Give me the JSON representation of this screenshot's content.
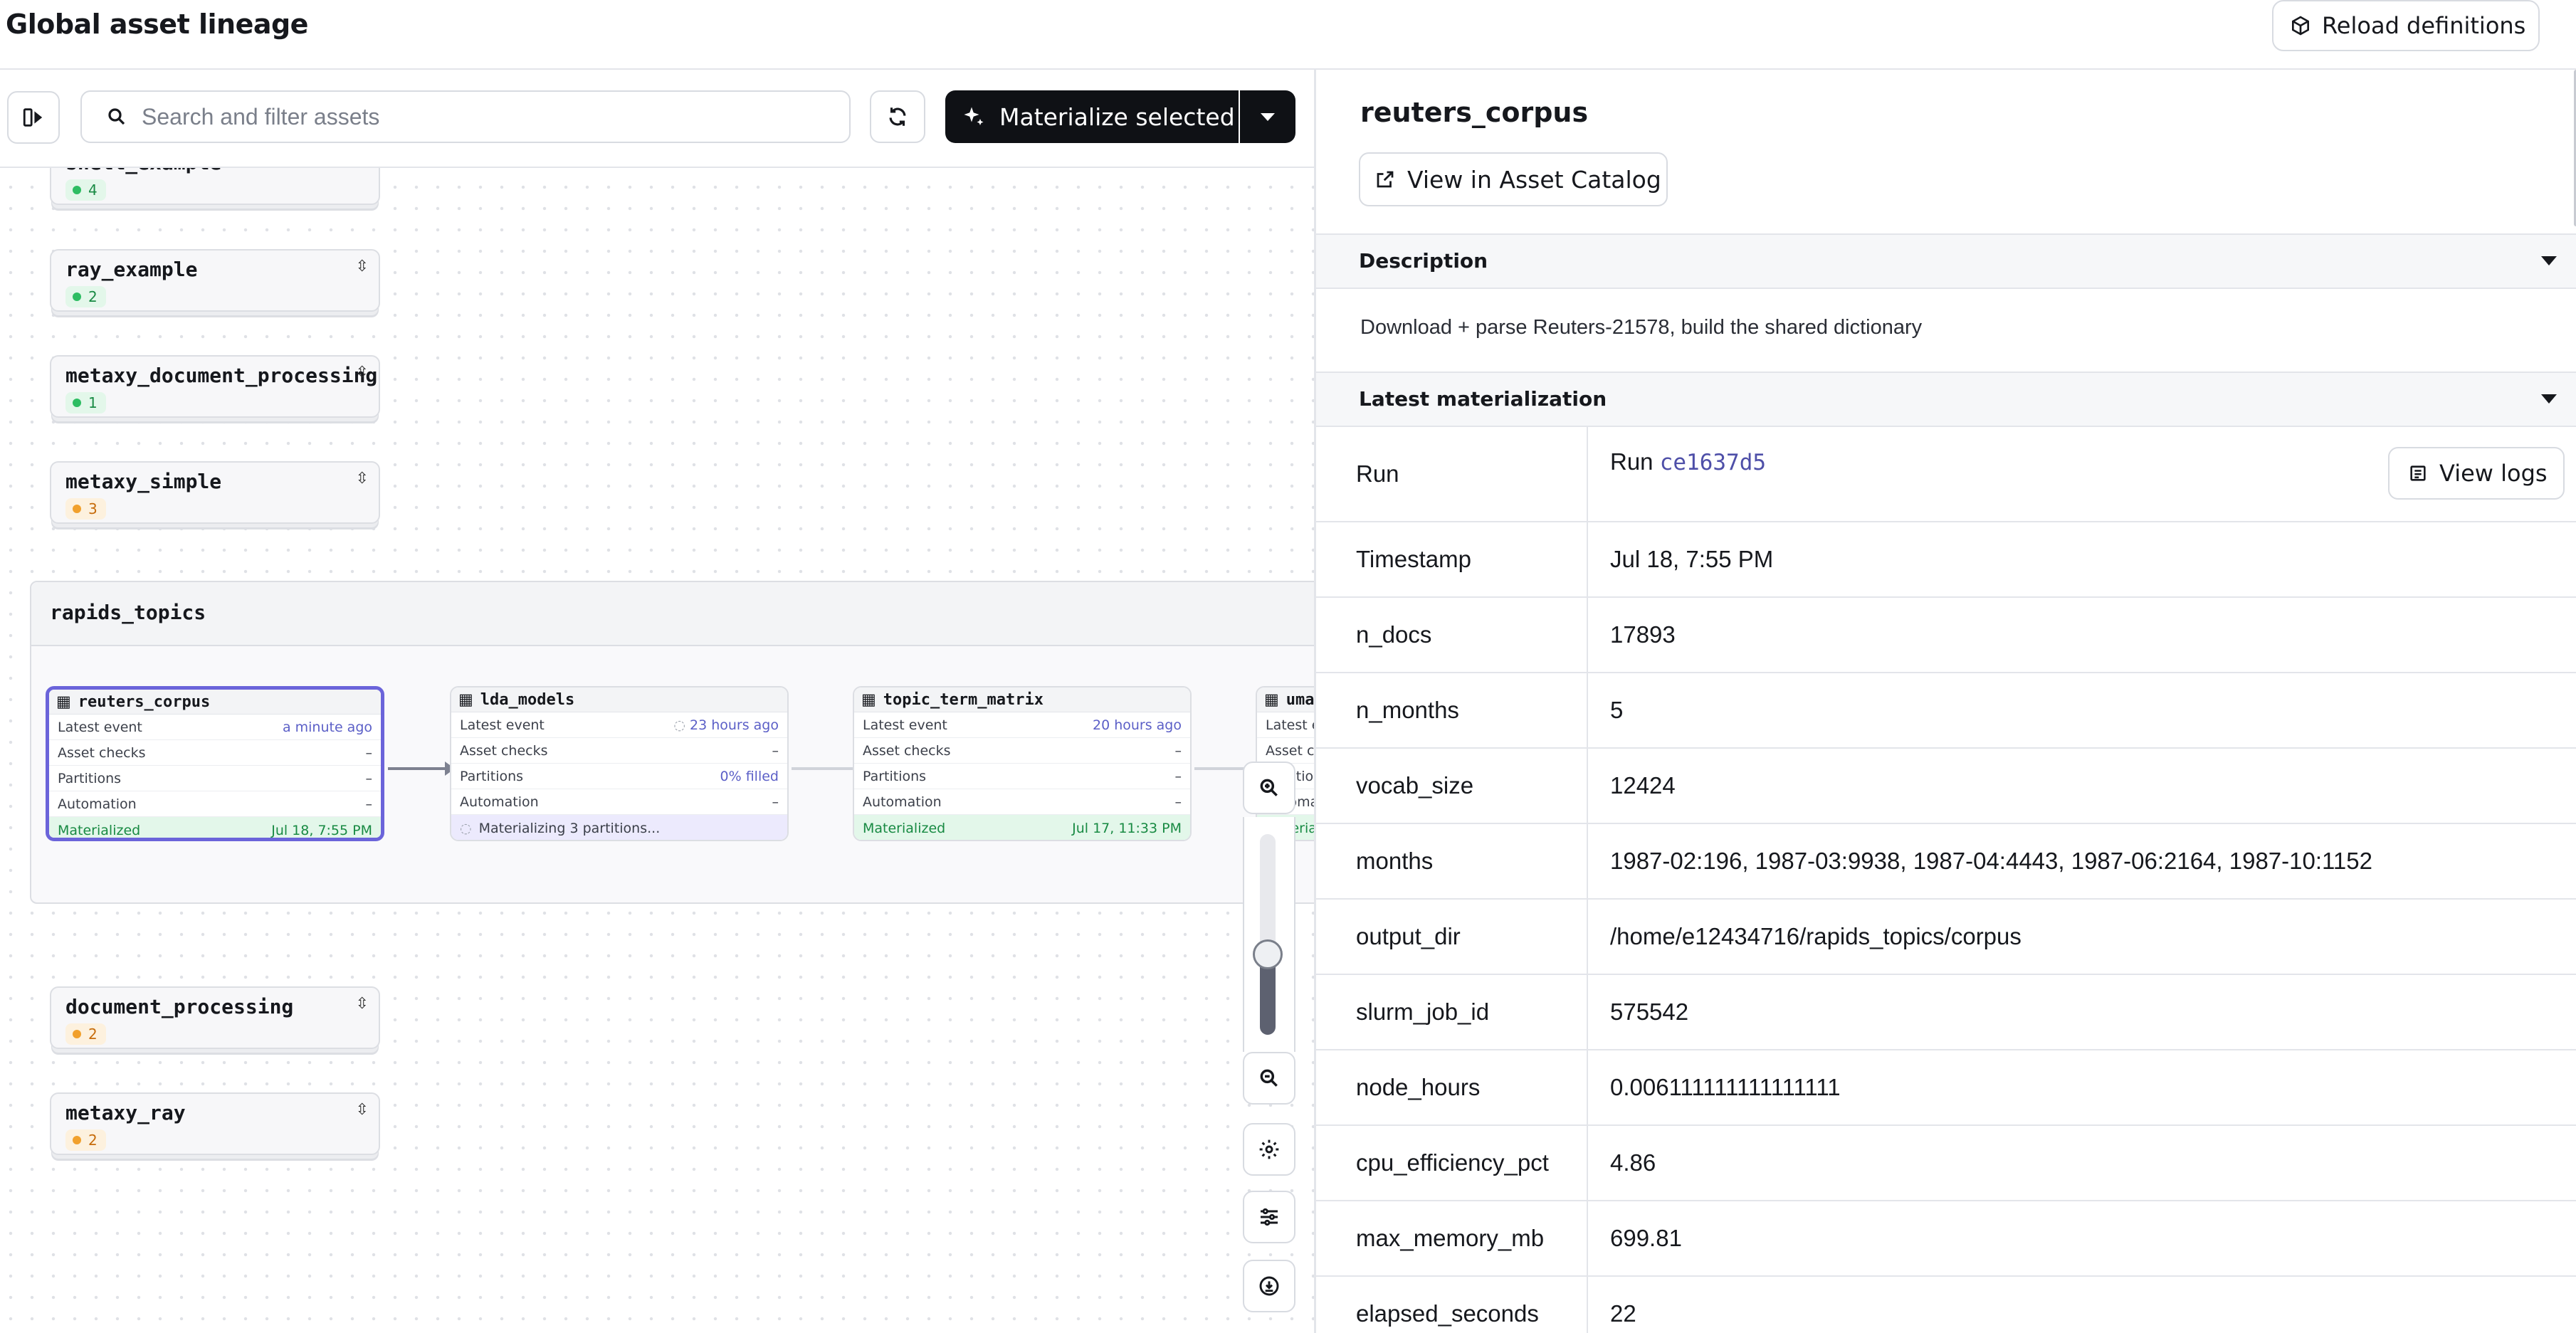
{
  "header": {
    "title": "Global asset lineage",
    "reload_label": "Reload definitions"
  },
  "toolbar": {
    "search_placeholder": "Search and filter assets",
    "materialize_label": "Materialize selected"
  },
  "groups_top": [
    {
      "name": "shell_example",
      "count": "4",
      "status": "green"
    },
    {
      "name": "ray_example",
      "count": "2",
      "status": "green"
    },
    {
      "name": "metaxy_document_processing",
      "count": "1",
      "status": "green"
    },
    {
      "name": "metaxy_simple",
      "count": "3",
      "status": "orange"
    }
  ],
  "rapids_group": {
    "name": "rapids_topics",
    "row_labels": {
      "latest_event": "Latest event",
      "asset_checks": "Asset checks",
      "partitions": "Partitions",
      "automation": "Automation"
    },
    "assets": [
      {
        "name": "reuters_corpus",
        "latest_event": "a minute ago",
        "asset_checks": "–",
        "partitions": "–",
        "automation": "–",
        "footer_label": "Materialized",
        "footer_time": "Jul 18, 7:55 PM"
      },
      {
        "name": "lda_models",
        "latest_event": "23 hours ago",
        "asset_checks": "–",
        "partitions": "0% filled",
        "automation": "–",
        "footer_label": "Materializing 3 partitions...",
        "footer_time": ""
      },
      {
        "name": "topic_term_matrix",
        "latest_event": "20 hours ago",
        "asset_checks": "–",
        "partitions": "–",
        "automation": "–",
        "footer_label": "Materialized",
        "footer_time": "Jul 17, 11:33 PM"
      },
      {
        "name": "umap",
        "latest_event": "",
        "asset_checks": "",
        "partitions": "",
        "automation": "",
        "footer_label": "",
        "footer_time": ""
      }
    ]
  },
  "groups_bottom": [
    {
      "name": "document_processing",
      "count": "2",
      "status": "orange"
    },
    {
      "name": "metaxy_ray",
      "count": "2",
      "status": "orange"
    }
  ],
  "zoom": {
    "level": 0.4
  },
  "detail": {
    "asset_name": "reuters_corpus",
    "catalog_label": "View in Asset Catalog",
    "description_title": "Description",
    "description": "Download + parse Reuters-21578, build the shared dictionary",
    "latest_title": "Latest materialization",
    "run_label": "Run",
    "run_prefix": "Run",
    "run_id": "ce1637d5",
    "view_logs_label": "View logs",
    "metadata": [
      {
        "key": "Timestamp",
        "value": "Jul 18, 7:55 PM"
      },
      {
        "key": "n_docs",
        "value": "17893"
      },
      {
        "key": "n_months",
        "value": "5"
      },
      {
        "key": "vocab_size",
        "value": "12424"
      },
      {
        "key": "months",
        "value": "1987-02:196, 1987-03:9938, 1987-04:4443, 1987-06:2164, 1987-10:1152"
      },
      {
        "key": "output_dir",
        "value": "/home/e12434716/rapids_topics/corpus"
      },
      {
        "key": "slurm_job_id",
        "value": "575542"
      },
      {
        "key": "node_hours",
        "value": "0.006111111111111111"
      },
      {
        "key": "cpu_efficiency_pct",
        "value": "4.86"
      },
      {
        "key": "max_memory_mb",
        "value": "699.81"
      },
      {
        "key": "elapsed_seconds",
        "value": "22"
      }
    ]
  },
  "colors": {
    "accent": "#6b64da",
    "success": "#2dbd62",
    "warning": "#f1a02c",
    "link": "#4e4fa8"
  }
}
